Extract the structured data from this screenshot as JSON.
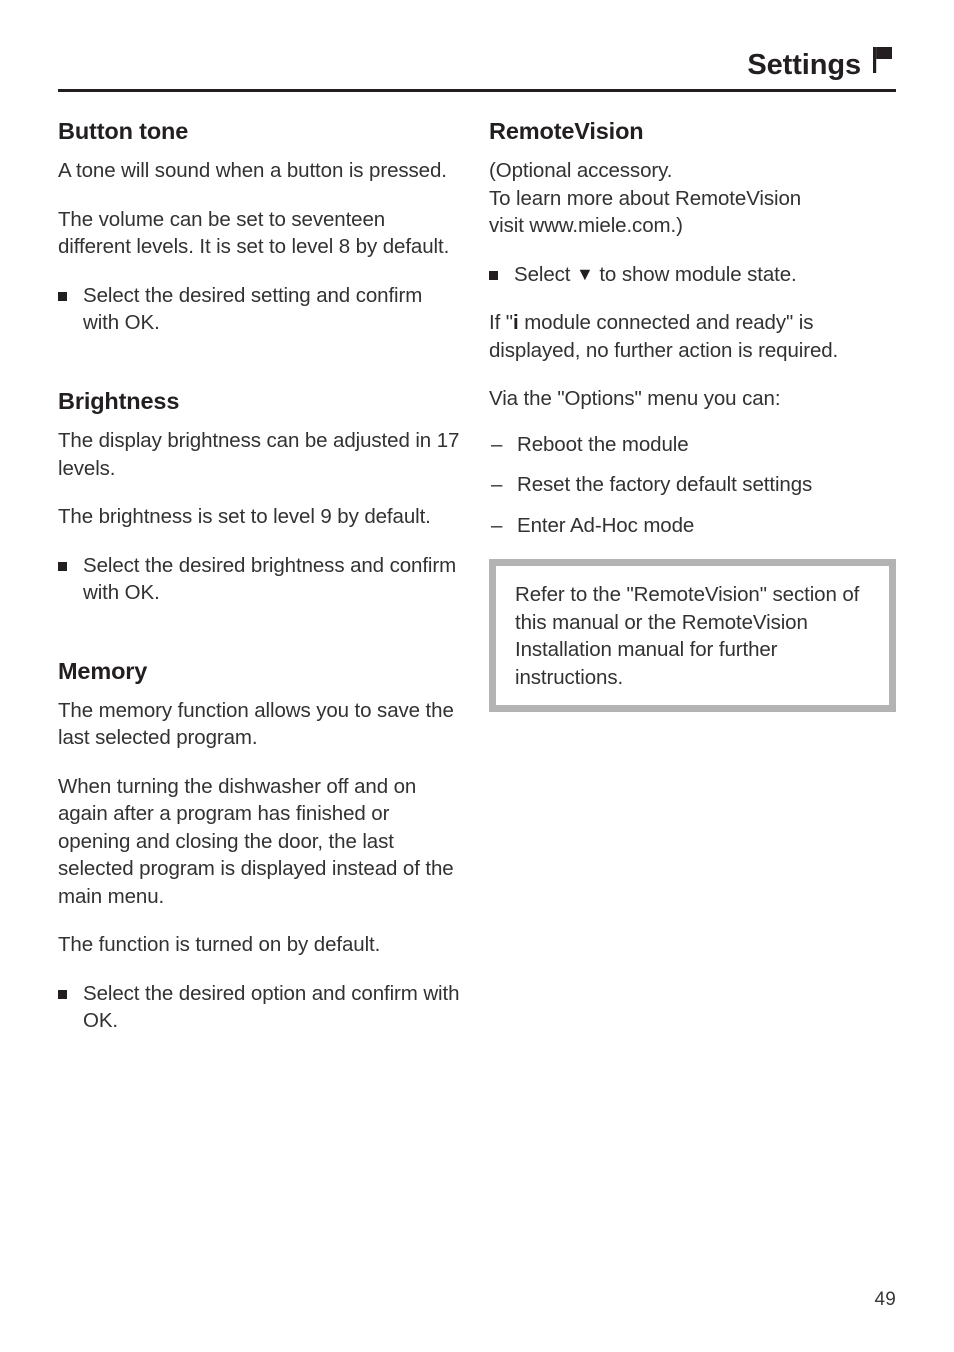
{
  "header": {
    "title": "Settings",
    "icon": "flag-icon"
  },
  "left_column": {
    "sections": [
      {
        "heading": "Button tone",
        "blocks": [
          {
            "type": "paragraph",
            "text": "A tone will sound when a button is pressed."
          },
          {
            "type": "paragraph",
            "text": "The volume can be set to seventeen different levels. It is set to level 8 by default."
          },
          {
            "type": "bullet",
            "text": "Select the desired setting and confirm with OK."
          }
        ]
      },
      {
        "heading": "Brightness",
        "blocks": [
          {
            "type": "paragraph",
            "text": "The display brightness can be adjusted in 17 levels."
          },
          {
            "type": "paragraph",
            "text": "The brightness is set to level 9 by default."
          },
          {
            "type": "bullet",
            "text": "Select the desired brightness and confirm with OK."
          }
        ]
      },
      {
        "heading": "Memory",
        "blocks": [
          {
            "type": "paragraph",
            "text": "The memory function allows you to save the last selected program."
          },
          {
            "type": "paragraph",
            "text": "When turning the dishwasher off and on again after a program has finished or opening and closing the door, the last selected program is displayed instead of the main menu."
          },
          {
            "type": "paragraph",
            "text": "The function is turned on by default."
          },
          {
            "type": "bullet",
            "text": "Select the desired option and confirm with OK."
          }
        ]
      }
    ]
  },
  "right_column": {
    "heading": "RemoteVision",
    "intro_line_1": "(Optional accessory.",
    "intro_line_2": "To learn more about RemoteVision",
    "intro_line_3": "visit www.miele.com.)",
    "bullet_select_prefix": "Select",
    "bullet_select_suffix": "to show module state.",
    "triangle_glyph": "▼",
    "if_prefix": "If \"",
    "info_glyph": "i",
    "if_suffix": "module connected and ready\" is displayed, no further action is required.",
    "via_options_text": "Via the \"Options\" menu you can:",
    "dash_items": [
      "Reboot the module",
      "Reset the factory default settings",
      "Enter Ad-Hoc mode"
    ],
    "note_box": {
      "text": "Refer to the \"RemoteVision\" section of this manual or the RemoteVision Installation manual for further instructions.",
      "border_color": "#b3b3b3"
    }
  },
  "footer": {
    "page_number": "49"
  }
}
